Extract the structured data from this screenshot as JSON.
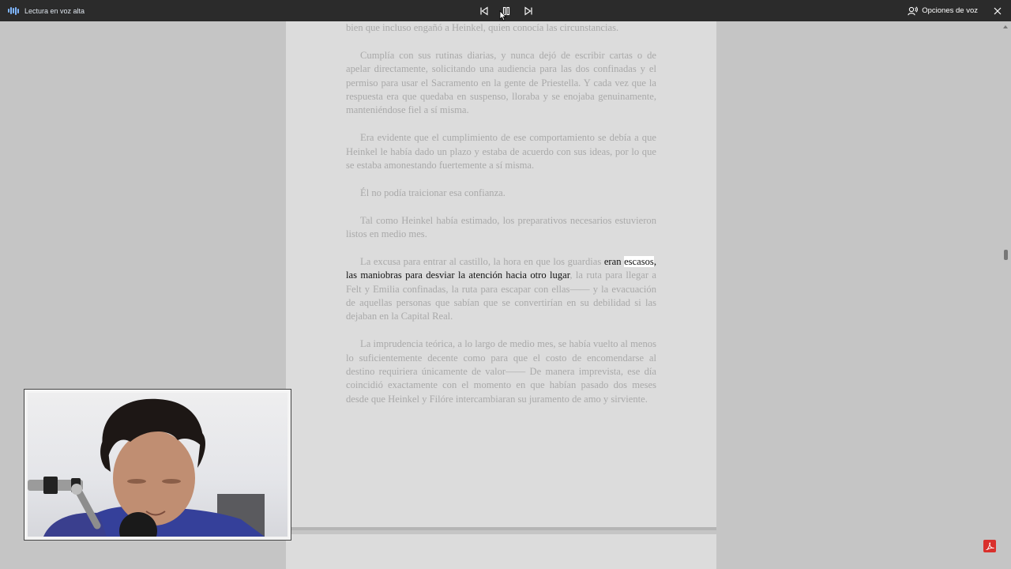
{
  "toolbar": {
    "title": "Lectura en voz alta",
    "voice_options_label": "Opciones de voz",
    "accent_color": "#7fb6ff",
    "icons": [
      "sound-wave-icon",
      "previous-icon",
      "pause-icon",
      "next-icon",
      "voice-person-icon",
      "close-icon"
    ]
  },
  "document": {
    "paragraphs": [
      "bien que incluso engañó a Heinkel, quien conocía las circunstancias.",
      "Cumplía con sus rutinas diarias, y nunca dejó de escribir cartas o de apelar directamente, solicitando una audiencia para las dos confinadas y el permiso para usar el Sacramento en la gente de Priestella. Y cada vez que la respuesta era que quedaba en suspenso, lloraba y se enojaba genuinamente, manteniéndose fiel a sí misma.",
      "Era evidente que el cumplimiento de ese comportamiento se debía a que Heinkel le había dado un plazo y estaba de acuerdo con sus ideas, por lo que se estaba amonestando fuertemente a sí misma.",
      "Él no podía traicionar esa confianza.",
      "Tal como Heinkel había estimado, los preparativos necesarios estuvieron listos en medio mes."
    ],
    "active_paragraph": {
      "before": "La excusa para entrar al castillo, la hora en que los guardias ",
      "active_pre": "eran ",
      "highlighted_word": "escasos",
      "active_post": ", las maniobras para desviar la atención hacia otro lugar",
      "after": ", la ruta para llegar a Felt y Emilia confinadas, la ruta para escapar con ellas—— y la evacuación de aquellas personas que sabían que se convertirían en su debilidad si las dejaban en la Capital Real."
    },
    "last_paragraph": "La imprudencia teórica, a lo largo de medio mes, se había vuelto al menos lo suficientemente decente como para que el costo de encomendarse al destino requiriera únicamente de valor—— De manera imprevista, ese día coincidió exactamente con el momento en que habían pasado dos meses desde que Heinkel y Filóre intercambiaran su juramento de amo y sirviente."
  }
}
